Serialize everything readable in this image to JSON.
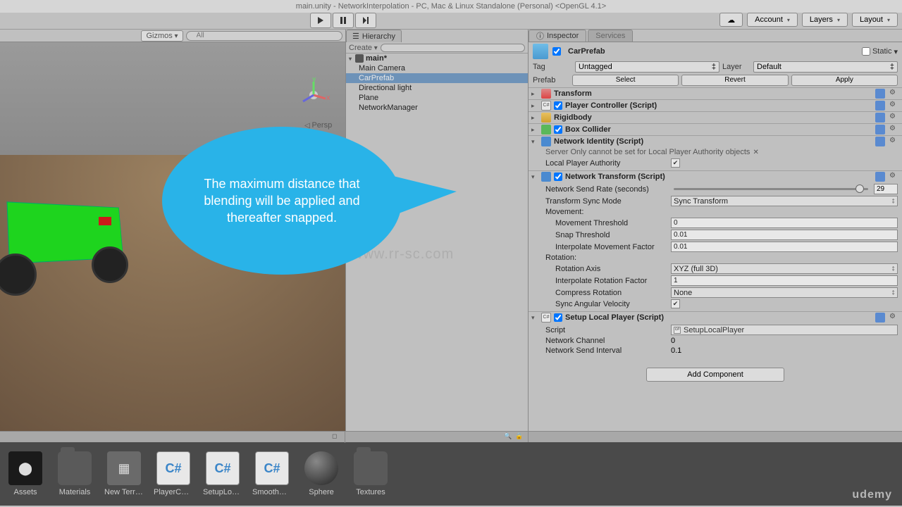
{
  "title": "main.unity - NetworkInterpolation - PC, Mac & Linux Standalone (Personal) <OpenGL 4.1>",
  "toolbar": {
    "account": "Account",
    "layers": "Layers",
    "layout": "Layout"
  },
  "scene": {
    "gizmos": "Gizmos",
    "persp": "Persp",
    "search_placeholder": "All"
  },
  "hierarchy": {
    "tab": "Hierarchy",
    "create": "Create",
    "root": "main*",
    "items": [
      "Main Camera",
      "CarPrefab",
      "Directional light",
      "Plane",
      "NetworkManager"
    ],
    "selected_index": 1
  },
  "inspector": {
    "tab": "Inspector",
    "tab2": "Services",
    "obj_name": "CarPrefab",
    "static": "Static",
    "tag_label": "Tag",
    "tag_value": "Untagged",
    "layer_label": "Layer",
    "layer_value": "Default",
    "prefab_label": "Prefab",
    "prefab_select": "Select",
    "prefab_revert": "Revert",
    "prefab_apply": "Apply",
    "components": {
      "transform": "Transform",
      "pc": "Player Controller (Script)",
      "rigid": "Rigidbody",
      "box": "Box Collider",
      "netid": "Network Identity (Script)",
      "netid_warn": "Server Only cannot be set for Local Player Authority objects",
      "netid_lpa": "Local Player Authority",
      "nettrans": "Network Transform (Script)",
      "nt_rate_label": "Network Send Rate (seconds)",
      "nt_rate_value": "29",
      "nt_mode_label": "Transform Sync Mode",
      "nt_mode_value": "Sync Transform",
      "nt_movement": "Movement:",
      "nt_movethresh_label": "Movement Threshold",
      "nt_movethresh_value": "0",
      "nt_snap_label": "Snap Threshold",
      "nt_snap_value": "0.01",
      "nt_interpmove_label": "Interpolate Movement Factor",
      "nt_interpmove_value": "0.01",
      "nt_rotation": "Rotation:",
      "nt_rotaxis_label": "Rotation Axis",
      "nt_rotaxis_value": "XYZ (full 3D)",
      "nt_interprot_label": "Interpolate Rotation Factor",
      "nt_interprot_value": "1",
      "nt_compress_label": "Compress Rotation",
      "nt_compress_value": "None",
      "nt_angular_label": "Sync Angular Velocity",
      "setup": "Setup Local Player (Script)",
      "setup_script_label": "Script",
      "setup_script_value": "SetupLocalPlayer",
      "setup_channel_label": "Network Channel",
      "setup_channel_value": "0",
      "setup_interval_label": "Network Send Interval",
      "setup_interval_value": "0.1"
    },
    "add_component": "Add Component"
  },
  "bubble": "The maximum distance that blending will be applied and thereafter snapped.",
  "project": {
    "assets": [
      {
        "label": "Assets",
        "type": "unity"
      },
      {
        "label": "Materials",
        "type": "folder"
      },
      {
        "label": "New Terrain",
        "type": "terrain"
      },
      {
        "label": "PlayerControl...",
        "type": "cs"
      },
      {
        "label": "SetupLocalPla...",
        "type": "cs"
      },
      {
        "label": "SmoothCamer...",
        "type": "cs"
      },
      {
        "label": "Sphere",
        "type": "sphere"
      },
      {
        "label": "Textures",
        "type": "folder"
      }
    ]
  },
  "watermark1": "www.rr-sc.com",
  "udemy": "udemy"
}
